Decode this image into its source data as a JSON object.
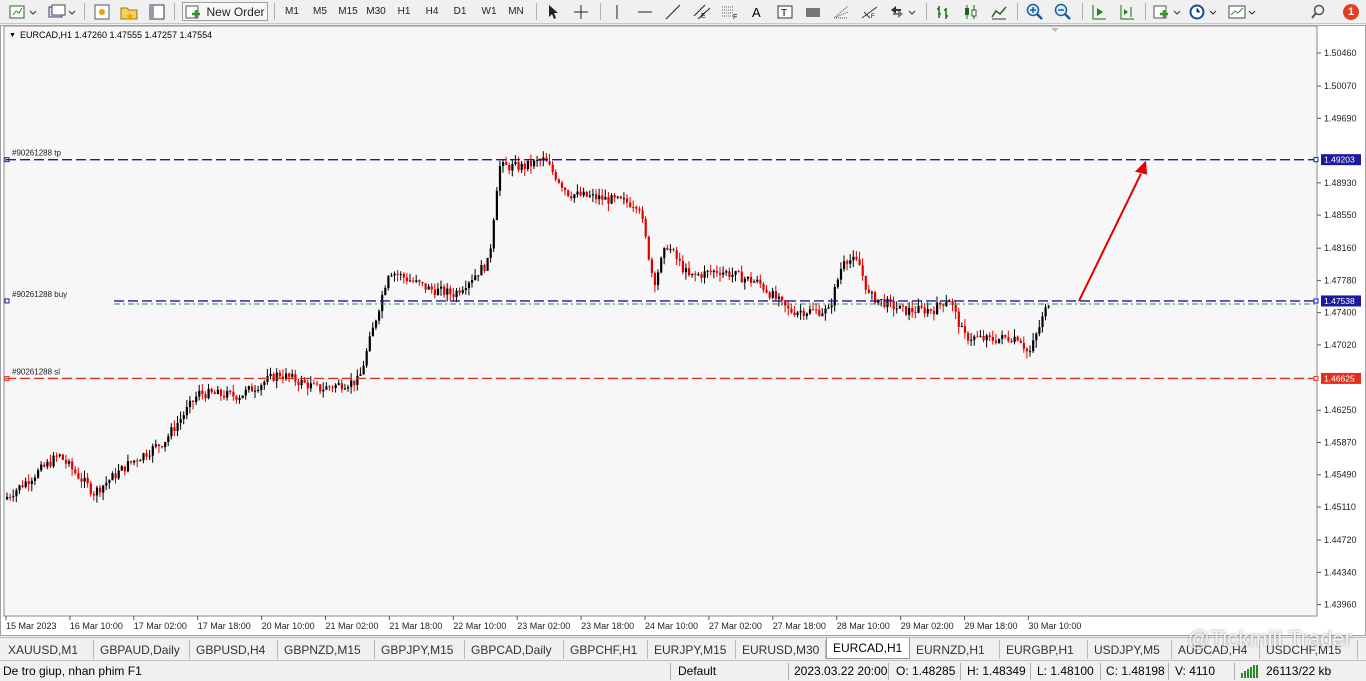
{
  "toolbar": {
    "new_order_label": "New Order",
    "timeframes": [
      "M1",
      "M5",
      "M15",
      "M30",
      "H1",
      "H4",
      "D1",
      "W1",
      "MN"
    ],
    "alert_badge": "1"
  },
  "chart": {
    "header": "EURCAD,H1  1.47260 1.47555 1.47257 1.47554",
    "price_axis": [
      "1.50460",
      "1.50070",
      "1.49690",
      "1.48930",
      "1.48550",
      "1.48160",
      "1.47780",
      "1.47400",
      "1.47020",
      "1.46250",
      "1.45870",
      "1.45490",
      "1.45110",
      "1.44720",
      "1.44340",
      "1.43960"
    ],
    "time_axis": [
      "15 Mar 2023",
      "16 Mar 10:00",
      "17 Mar 02:00",
      "17 Mar 18:00",
      "20 Mar 10:00",
      "21 Mar 02:00",
      "21 Mar 18:00",
      "22 Mar 10:00",
      "23 Mar 02:00",
      "23 Mar 18:00",
      "24 Mar 10:00",
      "27 Mar 02:00",
      "27 Mar 18:00",
      "28 Mar 10:00",
      "29 Mar 02:00",
      "29 Mar 18:00",
      "30 Mar 10:00"
    ],
    "orders": {
      "tp_label": "#90261288 tp",
      "buy_label": "#90261288 buy",
      "sl_label": "#90261288 sl",
      "tp_price": "1.49203",
      "buy_price": "1.47538",
      "sl_price": "1.46625"
    },
    "colors": {
      "bull": "#000000",
      "bear": "#e00000",
      "tp_line": "#1a1aa0",
      "buy_line": "#1a1aa0",
      "sl_line": "#e03020",
      "arrow": "#e00000"
    }
  },
  "tabs": [
    "XAUUSD,M1",
    "GBPAUD,Daily",
    "GBPUSD,H4",
    "GBPNZD,M15",
    "GBPJPY,M15",
    "GBPCAD,Daily",
    "GBPCHF,H1",
    "EURJPY,M15",
    "EURUSD,M30",
    "EURCAD,H1",
    "EURNZD,H1",
    "EURGBP,H1",
    "USDJPY,M5",
    "AUDCAD,H4",
    "USDCHF,M15"
  ],
  "active_tab": "EURCAD,H1",
  "watermark": "@Tickmill Trader",
  "status": {
    "help": "De tro giup, nhan phim F1",
    "profile": "Default",
    "datetime": "2023.03.22 20:00",
    "open": "O: 1.48285",
    "high": "H: 1.48349",
    "low": "L: 1.48100",
    "close": "C: 1.48198",
    "volume": "V: 4110",
    "traffic": "26113/22 kb"
  }
}
